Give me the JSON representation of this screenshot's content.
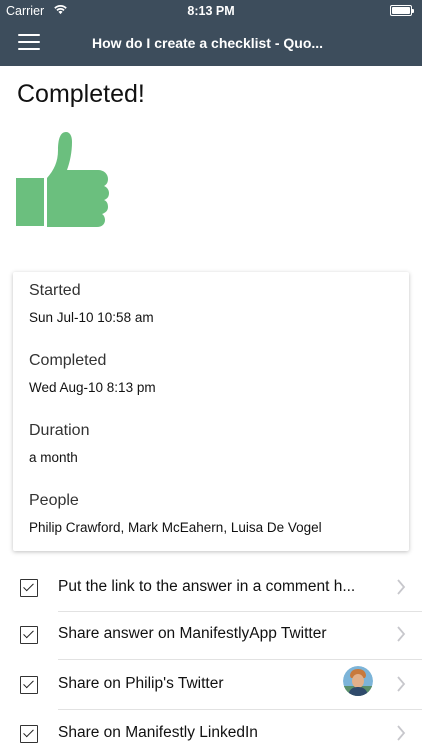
{
  "status_bar": {
    "carrier": "Carrier",
    "time": "8:13 PM",
    "wifi_icon": "wifi-icon",
    "battery_icon": "battery-icon"
  },
  "nav": {
    "menu_icon": "hamburger-menu-icon",
    "title": "How do I create a checklist - Quo..."
  },
  "page": {
    "title": "Completed!",
    "hero_icon": "thumbs-up-icon",
    "hero_color": "#6bbf7e"
  },
  "summary": {
    "started_label": "Started",
    "started_value": "Sun Jul-10 10:58 am",
    "completed_label": "Completed",
    "completed_value": "Wed Aug-10 8:13 pm",
    "duration_label": "Duration",
    "duration_value": "a month",
    "people_label": "People",
    "people_value": "Philip Crawford, Mark McEahern, Luisa De Vogel"
  },
  "tasks": [
    {
      "label": "Put the link to the answer in a comment h...",
      "checked": true
    },
    {
      "label": "Share answer on ManifestlyApp Twitter",
      "checked": true
    },
    {
      "label": "Share on Philip's Twitter",
      "checked": true,
      "avatar_icon": "user-avatar"
    },
    {
      "label": "Share on Manifestly LinkedIn",
      "checked": true
    }
  ],
  "colors": {
    "header_bg": "#3d4d5c",
    "accent_green": "#6bbf7e"
  }
}
